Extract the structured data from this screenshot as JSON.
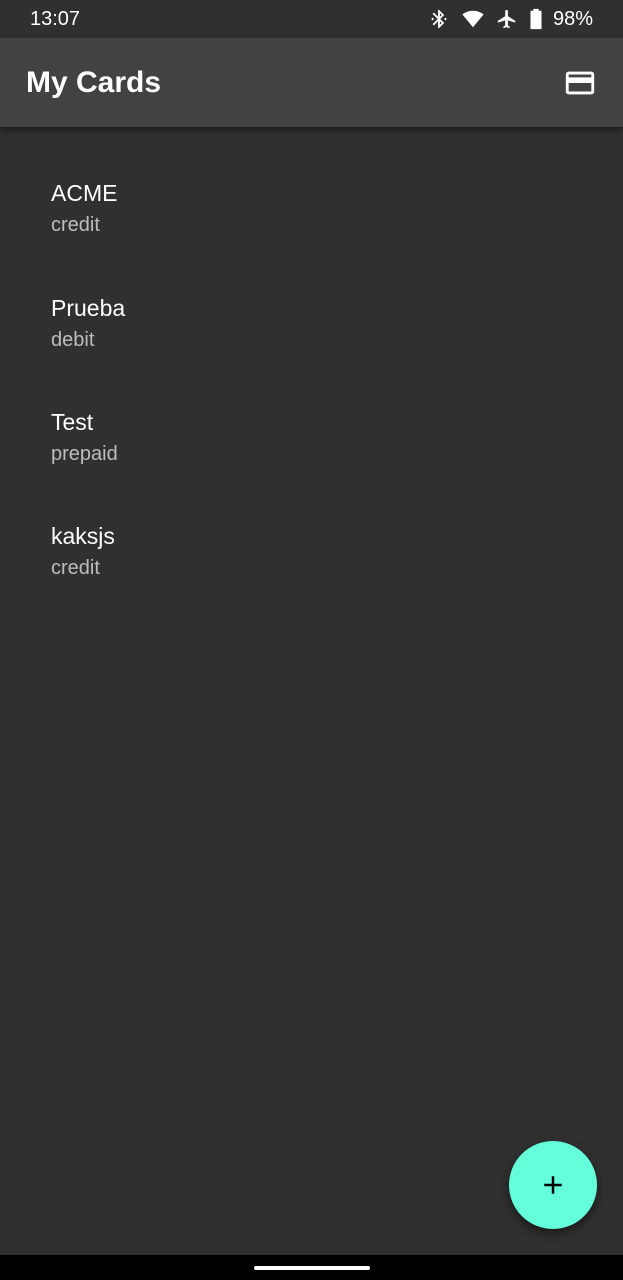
{
  "status_bar": {
    "time": "13:07",
    "battery_percent": "98%",
    "icons": [
      "bluetooth-icon",
      "wifi-icon",
      "airplane-mode-icon",
      "battery-icon"
    ]
  },
  "app_bar": {
    "title": "My Cards",
    "action_icon": "credit-card-icon"
  },
  "cards": [
    {
      "name": "ACME",
      "type": "credit"
    },
    {
      "name": "Prueba",
      "type": "debit"
    },
    {
      "name": "Test",
      "type": "prepaid"
    },
    {
      "name": "kaksjs",
      "type": "credit"
    }
  ],
  "fab": {
    "icon": "plus-icon"
  },
  "colors": {
    "background": "#303030",
    "app_bar": "#424242",
    "accent": "#64ffda",
    "secondary_text": "#bdbdbd"
  }
}
